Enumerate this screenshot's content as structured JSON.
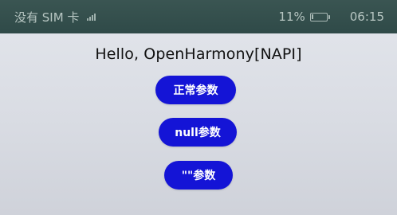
{
  "status_bar": {
    "carrier": "没有 SIM 卡",
    "battery_percent": "11%",
    "battery_level": 0.11,
    "time": "06:15"
  },
  "main": {
    "title": "Hello, OpenHarmony[NAPI]",
    "buttons": [
      {
        "label": "正常参数"
      },
      {
        "label": "null参数"
      },
      {
        "label": "\"\"参数"
      }
    ],
    "button_color": "#1414d6"
  }
}
